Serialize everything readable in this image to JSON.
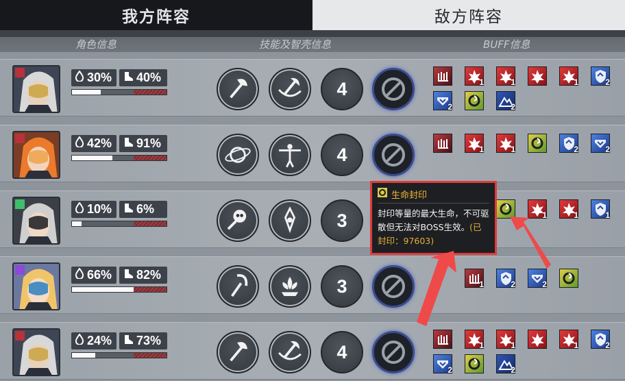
{
  "tabs": {
    "ours": "我方阵容",
    "enemy": "敌方阵容"
  },
  "headers": {
    "role": "角色信息",
    "skills": "技能及智壳信息",
    "buff": "BUFF信息"
  },
  "characters": [
    {
      "shield_pct": "30%",
      "hp_pct": "40%",
      "skill_count": "4",
      "hp_fraction": 0.4,
      "shield_fraction": 0.3,
      "buffs": [
        {
          "icon": "hp-icon",
          "color": "dark",
          "count": ""
        },
        {
          "icon": "explosion-icon",
          "color": "red",
          "count": "1"
        },
        {
          "icon": "explosion-icon",
          "color": "red",
          "count": "1"
        },
        {
          "icon": "explosion-icon",
          "color": "red",
          "count": ""
        },
        {
          "icon": "explosion-icon",
          "color": "red",
          "count": "1"
        },
        {
          "icon": "shield-icon",
          "color": "blue",
          "count": "2"
        },
        {
          "icon": "shield-down-icon",
          "color": "blue",
          "count": "2"
        },
        {
          "icon": "swirl-icon",
          "color": "ylw",
          "count": ""
        },
        {
          "icon": "mountain-icon",
          "color": "navy",
          "count": "2"
        }
      ]
    },
    {
      "shield_pct": "42%",
      "hp_pct": "91%",
      "skill_count": "4",
      "hp_fraction": 0.91,
      "shield_fraction": 0.42,
      "buffs": [
        {
          "icon": "hp-icon",
          "color": "dark",
          "count": ""
        },
        {
          "icon": "explosion-icon",
          "color": "red",
          "count": "1"
        },
        {
          "icon": "explosion-icon",
          "color": "red",
          "count": "1"
        },
        {
          "icon": "swirl-icon",
          "color": "ylw",
          "count": ""
        },
        {
          "icon": "shield-icon",
          "color": "blue",
          "count": "2"
        },
        {
          "icon": "shield-down-icon",
          "color": "blue",
          "count": "2"
        }
      ]
    },
    {
      "shield_pct": "10%",
      "hp_pct": "6%",
      "skill_count": "3",
      "hp_fraction": 0.06,
      "shield_fraction": 0.1,
      "buffs": [
        {
          "icon": "swirl-icon",
          "color": "ylw",
          "count": ""
        },
        {
          "icon": "explosion-icon",
          "color": "red",
          "count": "1"
        },
        {
          "icon": "explosion-icon",
          "color": "red",
          "count": "1"
        },
        {
          "icon": "shield-icon",
          "color": "blue",
          "count": "1"
        }
      ]
    },
    {
      "shield_pct": "66%",
      "hp_pct": "82%",
      "skill_count": "3",
      "hp_fraction": 0.82,
      "shield_fraction": 0.66,
      "buffs": [
        {
          "icon": "hp-icon",
          "color": "dark",
          "count": "1"
        },
        {
          "icon": "shield-icon",
          "color": "blue",
          "count": "2"
        },
        {
          "icon": "shield-down-icon",
          "color": "blue",
          "count": "2"
        },
        {
          "icon": "swirl-icon",
          "color": "ylw",
          "count": ""
        }
      ]
    },
    {
      "shield_pct": "24%",
      "hp_pct": "73%",
      "skill_count": "4",
      "hp_fraction": 0.73,
      "shield_fraction": 0.24,
      "buffs": [
        {
          "icon": "hp-icon",
          "color": "dark",
          "count": ""
        },
        {
          "icon": "explosion-icon",
          "color": "red",
          "count": "1"
        },
        {
          "icon": "explosion-icon",
          "color": "red",
          "count": "1"
        },
        {
          "icon": "explosion-icon",
          "color": "red",
          "count": ""
        },
        {
          "icon": "explosion-icon",
          "color": "red",
          "count": "1"
        },
        {
          "icon": "shield-icon",
          "color": "blue",
          "count": "2"
        },
        {
          "icon": "shield-down-icon",
          "color": "blue",
          "count": "2"
        },
        {
          "icon": "swirl-icon",
          "color": "ylw",
          "count": ""
        },
        {
          "icon": "mountain-icon",
          "color": "navy",
          "count": "2"
        }
      ]
    }
  ],
  "tooltip": {
    "title": "生命封印",
    "body": "封印等量的最大生命，不可驱散但无法对BOSS生效。",
    "extra": "(已封印：97603)"
  },
  "colors": {
    "accent_red": "#e03a3a",
    "tooltip_title": "#f2b530"
  }
}
